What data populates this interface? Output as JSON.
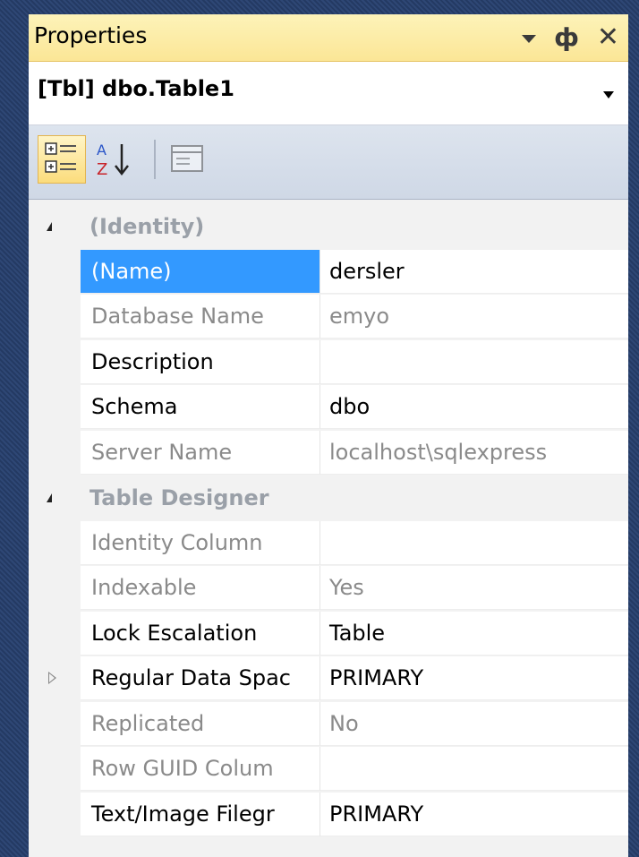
{
  "window": {
    "title": "Properties",
    "dropdown_icon": "dropdown-arrow-icon",
    "pin_icon": "pin-icon",
    "pin_glyph": "ф",
    "close_icon": "close-icon",
    "close_glyph": "✕"
  },
  "object_selector": {
    "label": "[Tbl] dbo.Table1"
  },
  "toolbar": {
    "buttons": [
      {
        "name": "categorized-icon",
        "active": true
      },
      {
        "name": "alphabetical-icon",
        "active": false
      },
      {
        "name": "property-pages-icon",
        "active": false
      }
    ]
  },
  "grid": {
    "categories": [
      {
        "label": "(Identity)",
        "properties": [
          {
            "name": "(Name)",
            "value": "dersler",
            "readonly": false,
            "selected": true
          },
          {
            "name": "Database Name",
            "value": "emyo",
            "readonly": true
          },
          {
            "name": "Description",
            "value": "",
            "readonly": false
          },
          {
            "name": "Schema",
            "value": "dbo",
            "readonly": false
          },
          {
            "name": "Server Name",
            "value": "localhost\\sqlexpress",
            "readonly": true
          }
        ]
      },
      {
        "label": "Table Designer",
        "properties": [
          {
            "name": "Identity Column",
            "value": "",
            "readonly": true
          },
          {
            "name": "Indexable",
            "value": "Yes",
            "readonly": true
          },
          {
            "name": "Lock Escalation",
            "value": "Table",
            "readonly": false
          },
          {
            "name": "Regular Data Spac",
            "value": "PRIMARY",
            "readonly": false,
            "expandable": true
          },
          {
            "name": "Replicated",
            "value": "No",
            "readonly": true
          },
          {
            "name": "Row GUID Colum",
            "value": "",
            "readonly": true
          },
          {
            "name": "Text/Image Filegr",
            "value": "PRIMARY",
            "readonly": false
          }
        ]
      }
    ]
  },
  "colors": {
    "title_bg": "#fbe696",
    "selection": "#3399ff",
    "readonly_text": "#8a8a8a",
    "category_text": "#9aa0a8"
  }
}
